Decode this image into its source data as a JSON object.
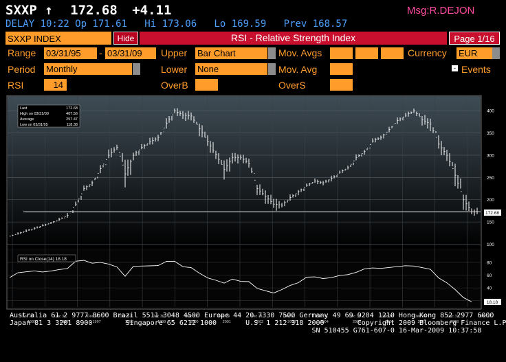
{
  "quote": {
    "ticker": "SXXP",
    "arrow": "↑",
    "last": "172.68",
    "change": "+4.11",
    "msg": "Msg:R.DEJON",
    "delay_line": "DELAY 10:22 Op 171.61   Hi 173.06   Lo 169.59   Prev 168.57"
  },
  "header": {
    "security": "SXXP INDEX",
    "hide_label": "Hide",
    "title": "RSI - Relative Strength Index",
    "page": "Page 1/16"
  },
  "form": {
    "range_label": "Range",
    "range_start": "03/31/95",
    "range_sep": "-",
    "range_end": "03/31/09",
    "upper_label": "Upper",
    "upper_value": "Bar Chart",
    "mov_avgs_label": "Mov. Avgs",
    "currency_label": "Currency",
    "currency_value": "EUR",
    "period_label": "Period",
    "period_value": "Monthly",
    "lower_label": "Lower",
    "lower_value": "None",
    "mov_avg_label": "Mov. Avg",
    "events_label": "Events",
    "events_box": "-",
    "rsi_label": "RSI",
    "rsi_value": "14",
    "overb_label": "OverB",
    "overs_label": "OverS"
  },
  "legend": {
    "last_label": "Last",
    "last_value": "172.68",
    "high_label": "High on 03/31/00",
    "high_value": "407.56",
    "avg_label": "Average",
    "avg_value": "257.47",
    "low_label": "Low on 03/31/95",
    "low_value": "118.38"
  },
  "rsi_legend": "RSI on Close(14) 18.18",
  "last_tag": "172.68",
  "rsi_tag": "18.18",
  "colors": {
    "accent": "#ff9c2a",
    "header_red": "#c8102e",
    "text_blue": "#4aa0ff",
    "chart_bg": "#2f3a42"
  },
  "chart_data": [
    {
      "type": "bar",
      "title": "",
      "y_ticks": [
        100,
        150,
        200,
        250,
        300,
        350,
        400
      ],
      "ylim": [
        90,
        425
      ],
      "last_line": 172.68,
      "x": [
        "1995-03",
        "1995-06",
        "1995-09",
        "1995-12",
        "1996-03",
        "1996-06",
        "1996-09",
        "1996-12",
        "1997-03",
        "1997-06",
        "1997-09",
        "1997-12",
        "1998-03",
        "1998-06",
        "1998-09",
        "1998-12",
        "1999-03",
        "1999-06",
        "1999-09",
        "1999-12",
        "2000-03",
        "2000-06",
        "2000-09",
        "2000-12",
        "2001-03",
        "2001-06",
        "2001-09",
        "2001-12",
        "2002-03",
        "2002-06",
        "2002-09",
        "2002-12",
        "2003-03",
        "2003-06",
        "2003-09",
        "2003-12",
        "2004-03",
        "2004-06",
        "2004-09",
        "2004-12",
        "2005-03",
        "2005-06",
        "2005-09",
        "2005-12",
        "2006-03",
        "2006-06",
        "2006-09",
        "2006-12",
        "2007-03",
        "2007-06",
        "2007-09",
        "2007-12",
        "2008-03",
        "2008-06",
        "2008-09",
        "2008-12",
        "2009-03"
      ],
      "close": [
        118,
        124,
        130,
        136,
        142,
        148,
        156,
        165,
        190,
        225,
        238,
        270,
        300,
        318,
        258,
        300,
        318,
        330,
        340,
        372,
        400,
        390,
        388,
        360,
        330,
        302,
        268,
        295,
        295,
        282,
        225,
        208,
        190,
        188,
        205,
        218,
        232,
        242,
        238,
        248,
        262,
        272,
        295,
        308,
        332,
        340,
        358,
        378,
        390,
        400,
        380,
        370,
        325,
        300,
        255,
        200,
        172.68
      ],
      "high": [
        122,
        128,
        134,
        140,
        146,
        152,
        160,
        170,
        200,
        232,
        248,
        278,
        318,
        325,
        290,
        310,
        325,
        340,
        352,
        388,
        407.56,
        402,
        396,
        378,
        345,
        315,
        295,
        305,
        305,
        292,
        248,
        228,
        202,
        198,
        212,
        225,
        238,
        248,
        245,
        255,
        268,
        278,
        302,
        315,
        340,
        348,
        365,
        385,
        398,
        405,
        395,
        385,
        345,
        318,
        290,
        225,
        185
      ],
      "low": [
        118.38,
        120,
        126,
        132,
        138,
        144,
        150,
        158,
        180,
        215,
        228,
        255,
        290,
        305,
        210,
        285,
        305,
        320,
        330,
        360,
        385,
        375,
        370,
        340,
        305,
        280,
        235,
        275,
        282,
        260,
        210,
        190,
        165,
        180,
        192,
        208,
        225,
        235,
        230,
        240,
        254,
        265,
        285,
        300,
        325,
        330,
        348,
        368,
        380,
        388,
        360,
        350,
        300,
        275,
        225,
        175,
        162
      ]
    },
    {
      "type": "line",
      "title": "",
      "series_name": "RSI on Close(14)",
      "y_ticks": [
        20,
        40,
        60,
        80
      ],
      "ylim": [
        10,
        95
      ],
      "x_tick_labels": [
        "Dec 29",
        "Dec 31",
        "Dec 31",
        "Dec 31",
        "Dec 30",
        "Dec 31",
        "Dec 29",
        "Dec 31",
        "Dec 31",
        "Dec 31",
        "Dec 30",
        "Dec 30",
        "Dec 29",
        "Dec 31",
        "Dec 31"
      ],
      "year_labels": [
        "1995",
        "1996",
        "1997",
        "1998",
        "1999",
        "2000",
        "2001",
        "2002",
        "2003",
        "2004",
        "2005",
        "2006",
        "2007",
        "2008"
      ],
      "values": [
        58,
        62,
        64,
        66,
        65,
        67,
        70,
        72,
        80,
        82,
        78,
        80,
        78,
        74,
        60,
        72,
        73,
        74,
        75,
        82,
        83,
        75,
        70,
        62,
        55,
        52,
        48,
        55,
        52,
        48,
        38,
        35,
        32,
        38,
        45,
        50,
        55,
        56,
        54,
        56,
        60,
        62,
        66,
        68,
        70,
        70,
        72,
        74,
        76,
        76,
        70,
        68,
        55,
        48,
        38,
        26,
        18.18
      ]
    }
  ]
}
